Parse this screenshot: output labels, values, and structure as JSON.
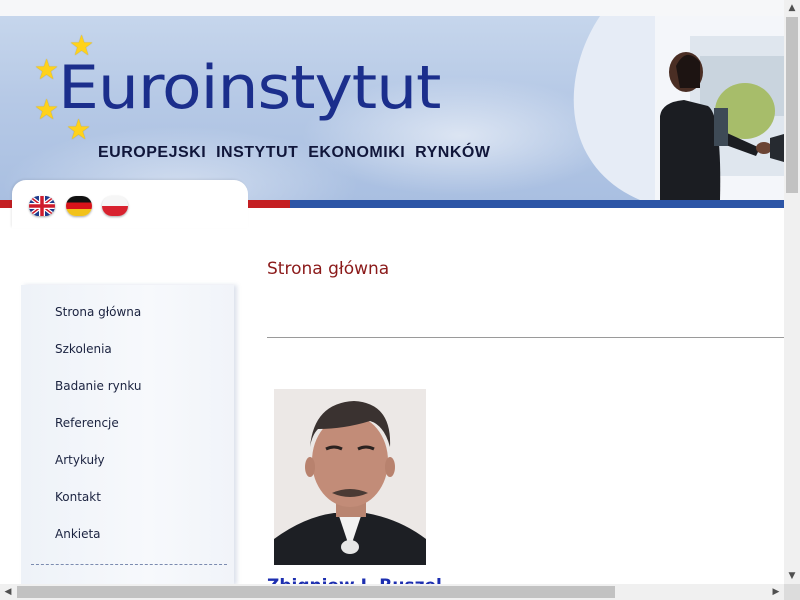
{
  "header": {
    "logo_title": "Euroinstytut",
    "logo_subtitle": "EUROPEJSKI INSTYTUT EKONOMIKI RYNKÓW",
    "star_glyph": "★",
    "languages": [
      "English",
      "Deutsch",
      "Polski"
    ]
  },
  "sidebar": {
    "items": [
      {
        "label": "Strona główna"
      },
      {
        "label": "Szkolenia"
      },
      {
        "label": "Badanie rynku"
      },
      {
        "label": "Referencje"
      },
      {
        "label": "Artykuły"
      },
      {
        "label": "Kontakt"
      },
      {
        "label": "Ankieta"
      }
    ]
  },
  "main": {
    "heading": "Strona główna",
    "person_name": "Zbigniew J. Ruszel"
  },
  "scrollbars": {
    "up": "▲",
    "down": "▼",
    "left": "◀",
    "right": "▶"
  },
  "colors": {
    "brand_blue": "#1b2e8c",
    "heading_red": "#8b1a1a",
    "stripe_red": "#c41f23",
    "stripe_blue": "#2c55a6",
    "star_yellow": "#ffd21a"
  }
}
